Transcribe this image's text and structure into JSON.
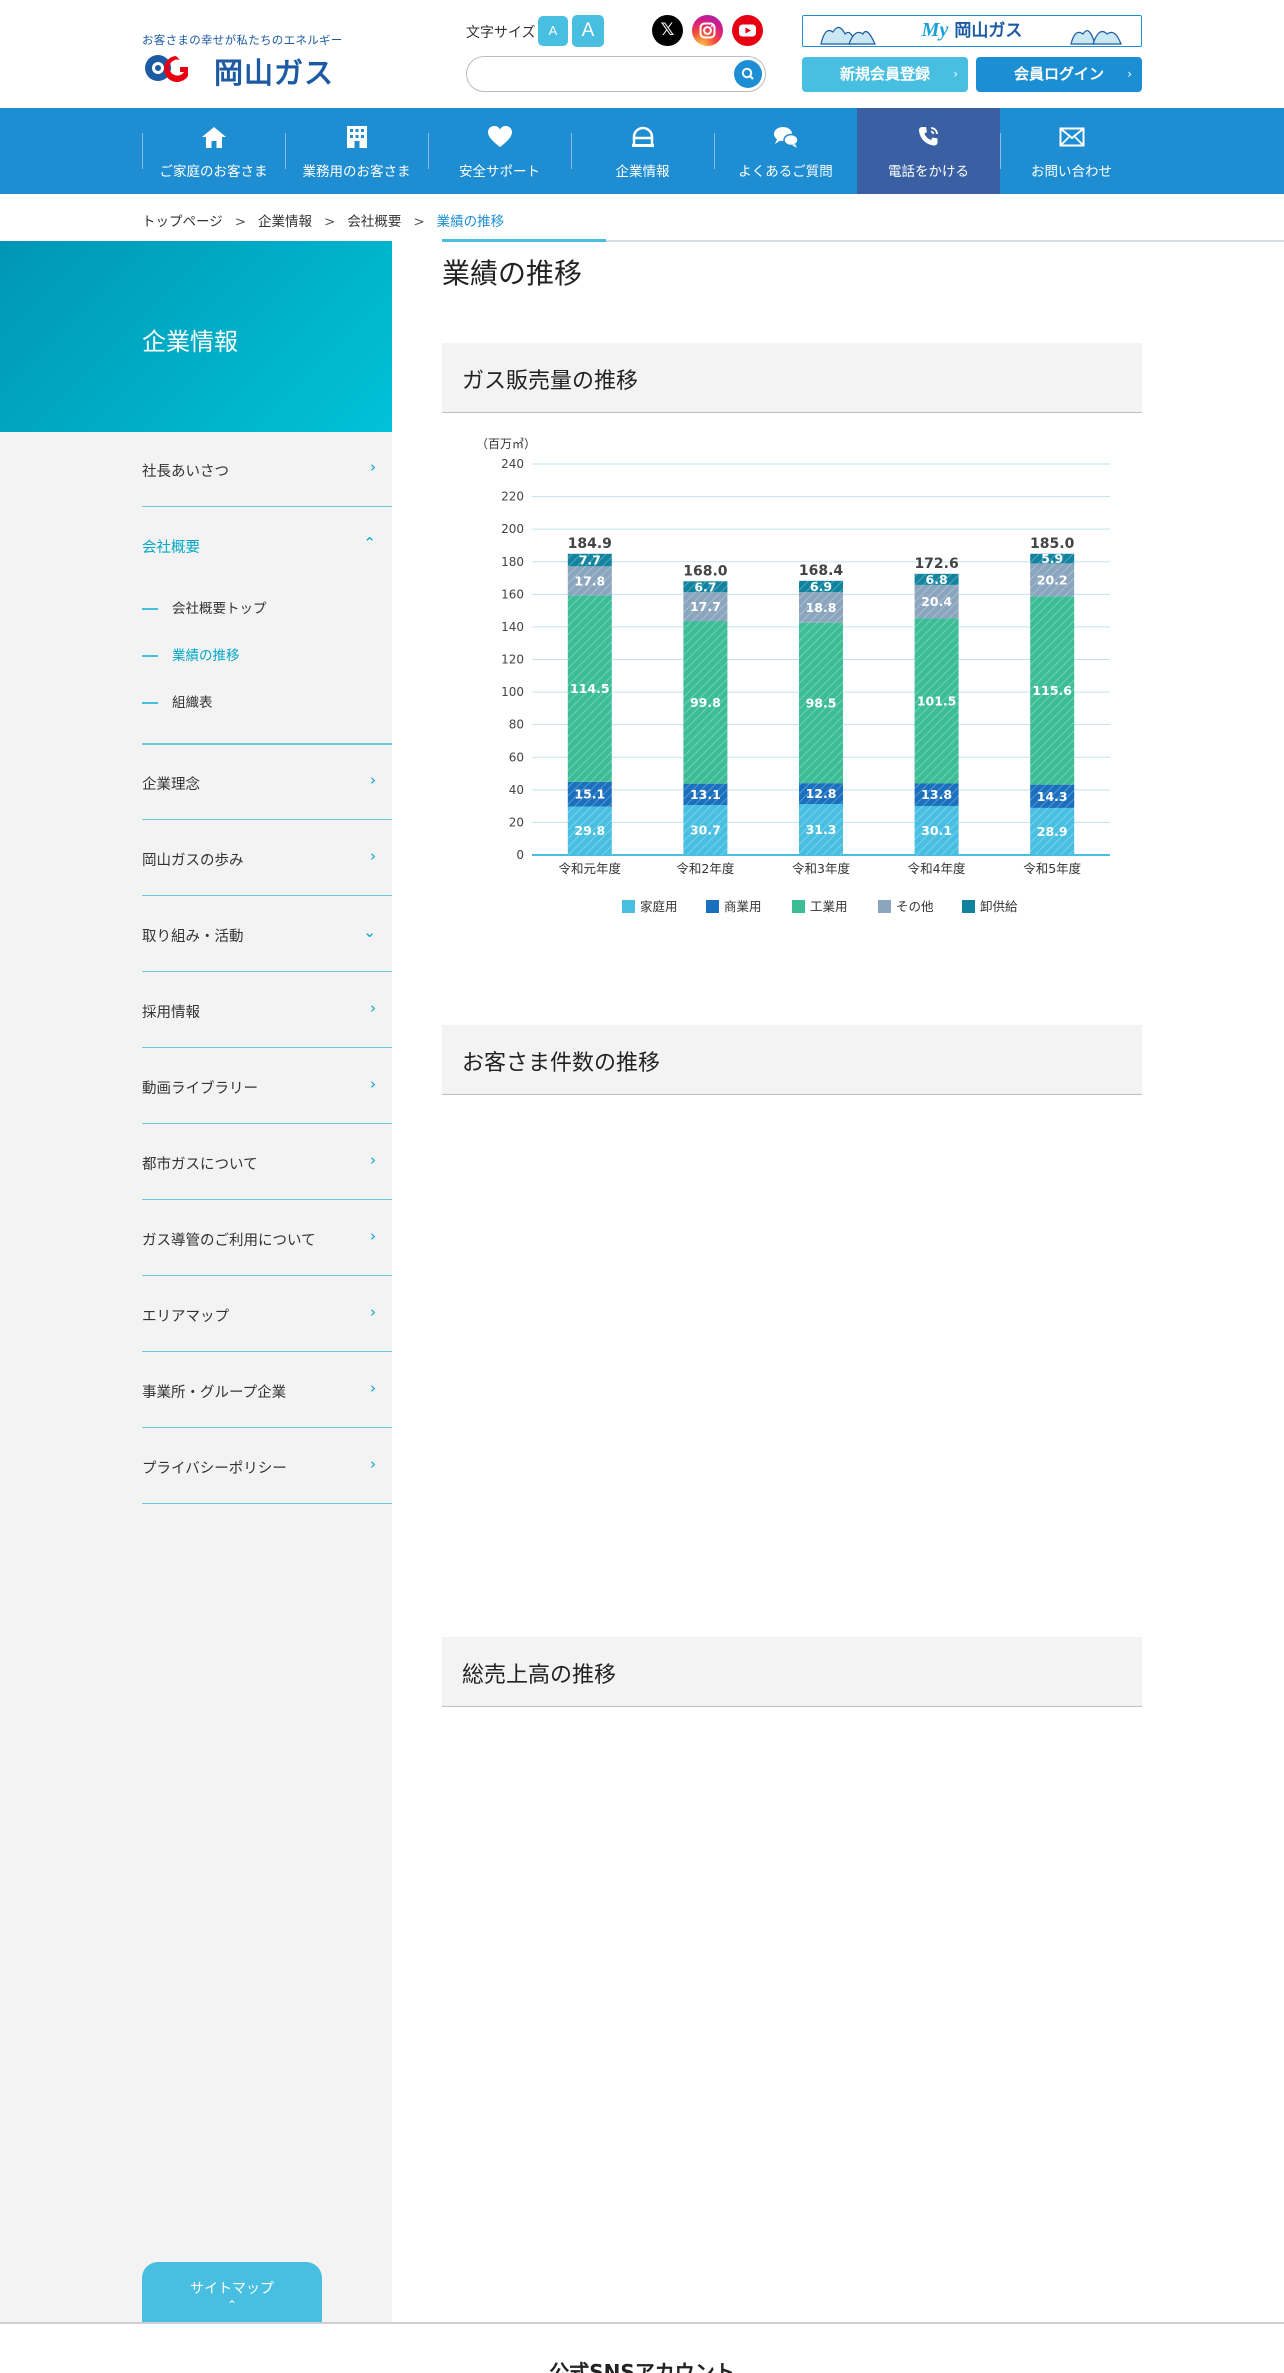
{
  "header": {
    "tagline": "お客さまの幸せが私たちのエネルギー",
    "logo_text": "岡山ガス",
    "font_size_label": "文字サイズ",
    "font_size_small": "A",
    "font_size_large": "A",
    "sns": [
      "x-icon",
      "instagram-icon",
      "youtube-icon"
    ],
    "search": {
      "value": "",
      "placeholder": ""
    },
    "mygas_prefix": "My",
    "mygas_label": "岡山ガス",
    "register_label": "新規会員登録",
    "login_label": "会員ログイン"
  },
  "nav": {
    "items": [
      {
        "label": "ご家庭のお客さま",
        "icon": "home-icon"
      },
      {
        "label": "業務用のお客さま",
        "icon": "building-icon"
      },
      {
        "label": "安全サポート",
        "icon": "heart-icon"
      },
      {
        "label": "企業情報",
        "icon": "helmet-icon"
      },
      {
        "label": "よくあるご質問",
        "icon": "chat-icon"
      },
      {
        "label": "電話をかける",
        "icon": "phone-icon"
      },
      {
        "label": "お問い合わせ",
        "icon": "mail-icon"
      }
    ]
  },
  "breadcrumb": [
    "トップページ",
    "企業情報",
    "会社概要",
    "業績の推移"
  ],
  "sidebar": {
    "title": "企業情報",
    "items": [
      {
        "label": "社長あいさつ"
      },
      {
        "label": "会社概要"
      },
      {
        "label": "企業理念"
      },
      {
        "label": "岡山ガスの歩み"
      },
      {
        "label": "取り組み・活動"
      },
      {
        "label": "採用情報"
      },
      {
        "label": "動画ライブラリー"
      },
      {
        "label": "都市ガスについて"
      },
      {
        "label": "ガス導管のご利用について"
      },
      {
        "label": "エリアマップ"
      },
      {
        "label": "事業所・グループ企業"
      },
      {
        "label": "プライバシーポリシー"
      }
    ],
    "subitems": [
      {
        "label": "会社概要トップ"
      },
      {
        "label": "業績の推移"
      },
      {
        "label": "組織表"
      }
    ],
    "sitemap_label": "サイトマップ",
    "sitemap_arrow": "⌃"
  },
  "main": {
    "title": "業績の推移",
    "sections": [
      {
        "title": "ガス販売量の推移"
      },
      {
        "title": "お客さま件数の推移"
      },
      {
        "title": "総売上高の推移"
      }
    ]
  },
  "footer": {
    "title": "公式SNSアカウント"
  },
  "colors": {
    "accent": "#1f8dd1",
    "teal": "#48bfe0",
    "nav_tel": "#3a5fa3"
  },
  "chart_data": {
    "type": "bar",
    "stacked": true,
    "unit": "（百万㎥）",
    "categories": [
      "令和元年度",
      "令和2年度",
      "令和3年度",
      "令和4年度",
      "令和5年度"
    ],
    "ylim": [
      0,
      240
    ],
    "yticks": [
      0,
      20,
      40,
      60,
      80,
      100,
      120,
      140,
      160,
      180,
      200,
      220,
      240
    ],
    "series": [
      {
        "name": "家庭用",
        "color": "#48bfe0",
        "values": [
          29.8,
          30.7,
          31.3,
          30.1,
          28.9
        ]
      },
      {
        "name": "商業用",
        "color": "#1a6fbe",
        "values": [
          15.1,
          13.1,
          12.8,
          13.8,
          14.3
        ]
      },
      {
        "name": "工業用",
        "color": "#3dbd96",
        "values": [
          114.5,
          99.8,
          98.5,
          101.5,
          115.6
        ]
      },
      {
        "name": "その他",
        "color": "#8aa5bd",
        "values": [
          17.8,
          17.7,
          18.8,
          20.4,
          20.2
        ]
      },
      {
        "name": "卸供給",
        "color": "#11839e",
        "values": [
          7.7,
          6.7,
          6.9,
          6.8,
          5.9
        ]
      }
    ],
    "totals": [
      "184.9",
      "168.0",
      "168.4",
      "172.6",
      "185.0"
    ],
    "grid": true,
    "legend": "bottom"
  }
}
